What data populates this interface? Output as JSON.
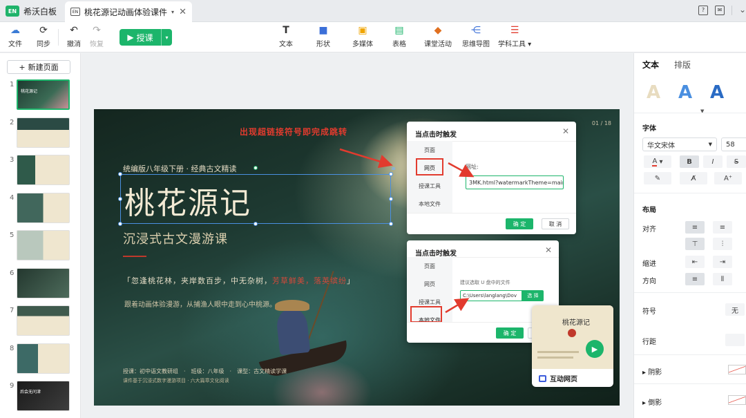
{
  "titlebar": {
    "app_name": "希沃白板",
    "doc_icon": "EN",
    "doc_name": "桃花源记动画体验课件"
  },
  "toolbar": {
    "file": "文件",
    "sync": "同步",
    "undo": "撤消",
    "redo": "恢复",
    "teach": "授课",
    "tools": [
      "文本",
      "形状",
      "多媒体",
      "表格",
      "课堂活动",
      "思维导图",
      "学科工具"
    ]
  },
  "sidebar": {
    "new_page": "新建页面",
    "thumbs": [
      {
        "num": "1",
        "label": "桃花源记"
      },
      {
        "num": "2",
        "label": ""
      },
      {
        "num": "3",
        "label": ""
      },
      {
        "num": "4",
        "label": ""
      },
      {
        "num": "5",
        "label": ""
      },
      {
        "num": "6",
        "label": ""
      },
      {
        "num": "7",
        "label": ""
      },
      {
        "num": "8",
        "label": ""
      },
      {
        "num": "9",
        "label": "后会无问津"
      }
    ]
  },
  "slide": {
    "meta": "统编版八年级下册 · 经典古文精读",
    "title": "桃花源记",
    "subtitle": "沉浸式古文漫游课",
    "quote_a": "「忽逢桃花林，夹岸数百步，中无杂树，",
    "quote_b": "芳草鲜美，落英缤纷",
    "quote_c": "」",
    "line2": "跟着动画体验漫游，从捕渔人眼中走到心中桃源。",
    "foot1": "授课：初中语文教研组　·　班级：八年级　·　课型：古文精读学课",
    "foot2": "课件基于沉浸式数字漫游项目 · 六大篇章文化阅读",
    "pagenum": "01 / 18",
    "annotation": "出现超链接符号即完成跳转"
  },
  "dialog1": {
    "title": "当点击时触发",
    "nav": [
      "页面",
      "网页",
      "授课工具",
      "本地文件"
    ],
    "url_label": "网址:",
    "url_value": "3MK.html?watermarkTheme=main",
    "ok": "确 定",
    "cancel": "取 消"
  },
  "dialog2": {
    "title": "当点击时触发",
    "nav": [
      "页面",
      "网页",
      "授课工具",
      "本地文件"
    ],
    "hint": "建议选取 U 盘中的文件",
    "path_value": "C:\\Users\\langlang\\Dov",
    "choose": "选 择",
    "ok": "确 定",
    "cancel": "取 消"
  },
  "card": {
    "title": "桃花源记",
    "label": "互动网页"
  },
  "rpanel": {
    "tab_text": "文本",
    "tab_layout": "排版",
    "font_section": "字体",
    "font_family": "华文宋体",
    "font_size": "58",
    "layout_section": "布局",
    "align": "对齐",
    "indent": "缩进",
    "direction": "方向",
    "symbol": "符号",
    "symbol_value": "无",
    "line_spacing": "行距",
    "shadow": "阴影",
    "reflection": "倒影"
  },
  "colors": {
    "brand": "#1cb56b",
    "annotation_red": "#e23b2e",
    "selection_blue": "#4a90e2"
  }
}
